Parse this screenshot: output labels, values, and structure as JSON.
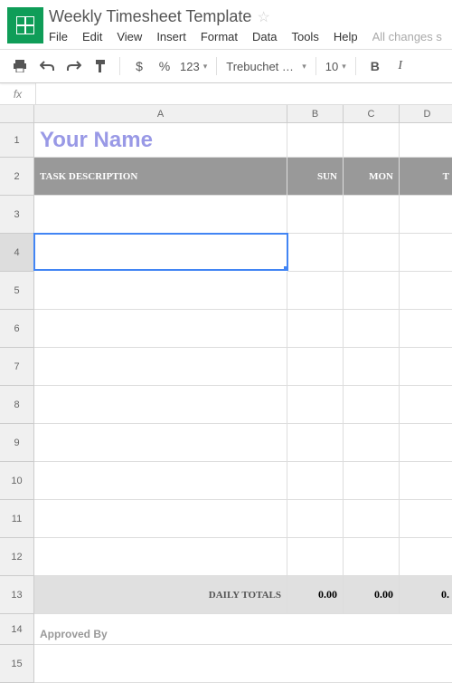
{
  "header": {
    "doc_title": "Weekly Timesheet Template",
    "menus": [
      "File",
      "Edit",
      "View",
      "Insert",
      "Format",
      "Data",
      "Tools",
      "Help"
    ],
    "autosave": "All changes s"
  },
  "toolbar": {
    "currency": "$",
    "percent": "%",
    "num_format": "123",
    "font_name": "Trebuchet …",
    "font_size": "10",
    "bold": "B",
    "italic": "I"
  },
  "formula": {
    "label": "fx"
  },
  "columns": [
    "A",
    "B",
    "C",
    "D"
  ],
  "rows": [
    "1",
    "2",
    "3",
    "4",
    "5",
    "6",
    "7",
    "8",
    "9",
    "10",
    "11",
    "12",
    "13",
    "14",
    "15"
  ],
  "sheet": {
    "title_cell": "Your Name",
    "header_row": {
      "task": "TASK DESCRIPTION",
      "sun": "SUN",
      "mon": "MON",
      "tue_partial": "T"
    },
    "totals_row": {
      "label": "DAILY TOTALS",
      "sun": "0.00",
      "mon": "0.00",
      "tue_partial": "0."
    },
    "approved_by": "Approved By"
  },
  "selected": {
    "row": 4,
    "col": "A"
  }
}
